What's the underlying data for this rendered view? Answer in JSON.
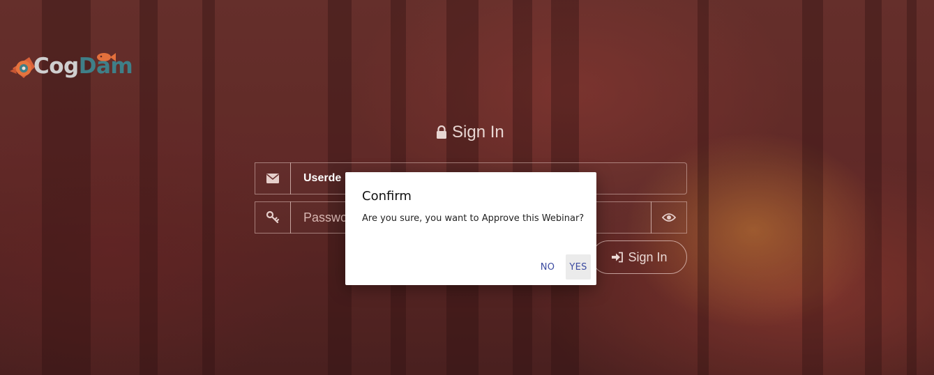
{
  "brand": {
    "logo_cog": "Cog",
    "logo_dam": "Dam"
  },
  "login": {
    "title": "Sign In",
    "email_value": "Userde",
    "password_placeholder": "Passwo",
    "submit_label": "Sign In"
  },
  "dialog": {
    "title": "Confirm",
    "message": "Are you sure, you want to Approve this Webinar?",
    "no_label": "NO",
    "yes_label": "YES"
  },
  "icons": {
    "lock": "lock-icon",
    "email": "envelope-icon",
    "password": "key-icon",
    "toggle": "eye-icon",
    "submit": "sign-in-icon"
  },
  "colors": {
    "accent": "#3b4aa0",
    "logo_teal": "#3f7f88",
    "logo_orange": "#e0683a"
  }
}
